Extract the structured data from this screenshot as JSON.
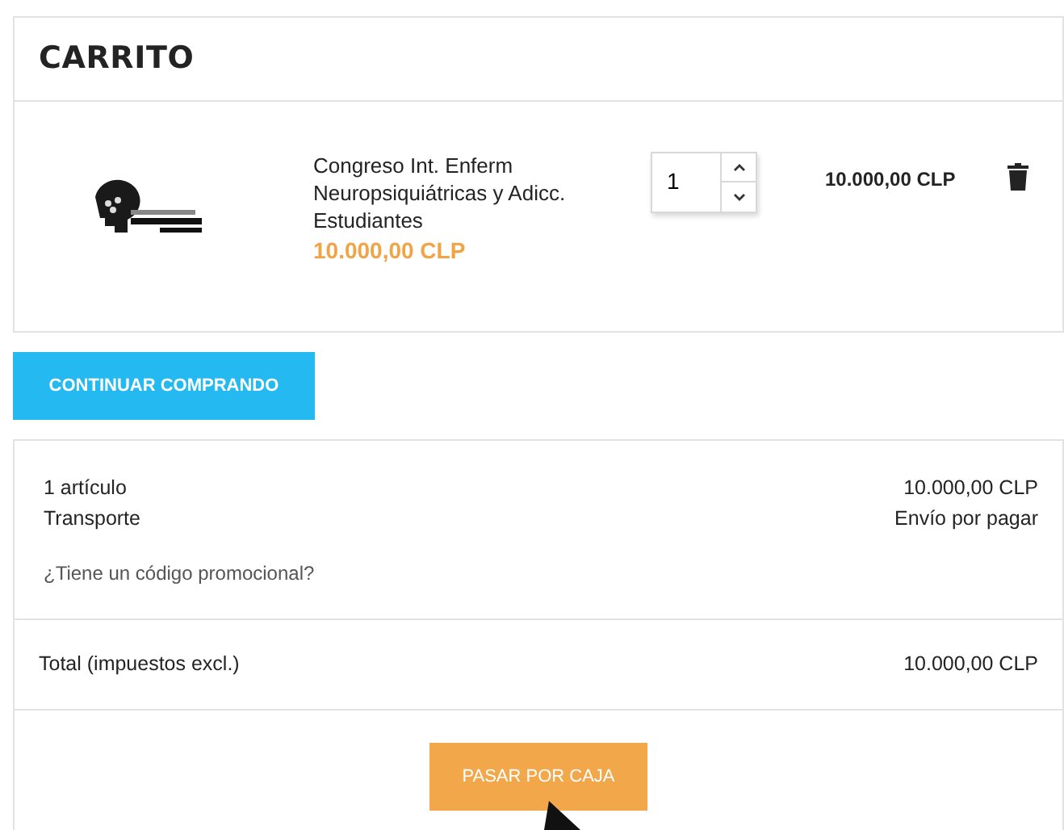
{
  "cart": {
    "title": "CARRITO",
    "items": [
      {
        "name": "Congreso Int. Enferm Neuropsiquiátricas y Adicc. Estudiantes",
        "unit_price": "10.000,00 CLP",
        "quantity": "1",
        "total": "10.000,00 CLP"
      }
    ],
    "continue_button": "CONTINUAR COMPRANDO"
  },
  "summary": {
    "lines": [
      {
        "label": "1 artículo",
        "value": "10.000,00 CLP"
      },
      {
        "label": "Transporte",
        "value": "Envío por pagar"
      }
    ],
    "promo_link": "¿Tiene un código promocional?",
    "total": {
      "label": "Total (impuestos excl.)",
      "value": "10.000,00 CLP"
    },
    "checkout_button": "PASAR POR CAJA"
  }
}
